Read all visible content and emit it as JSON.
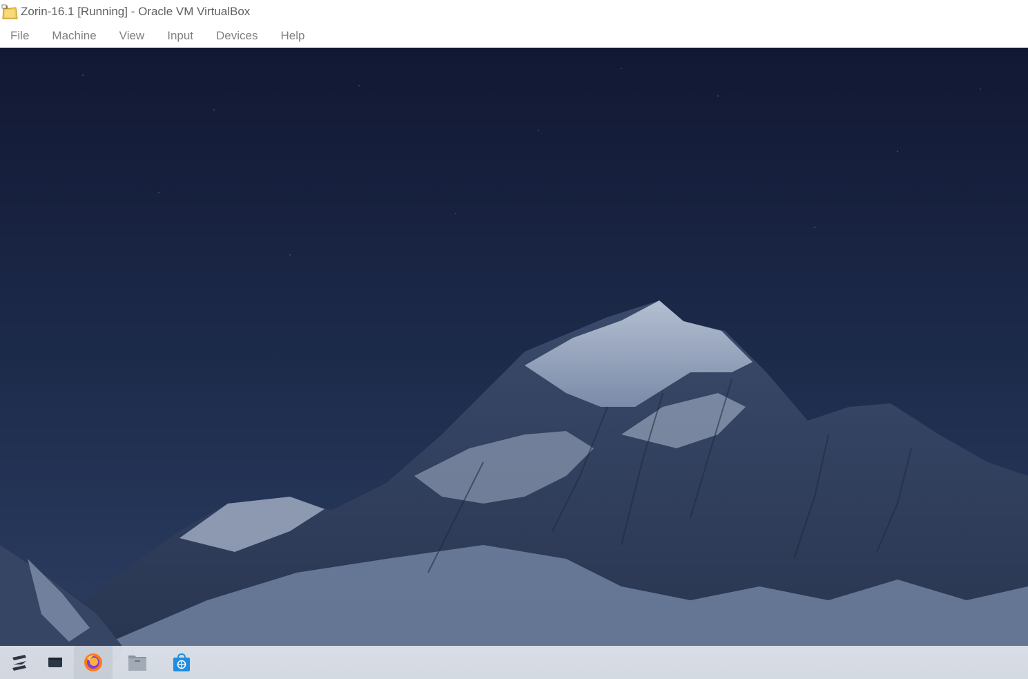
{
  "window": {
    "title": "Zorin-16.1 [Running] - Oracle VM VirtualBox",
    "icon": "virtualbox-folder-icon"
  },
  "menubar": {
    "items": [
      {
        "label": "File"
      },
      {
        "label": "Machine"
      },
      {
        "label": "View"
      },
      {
        "label": "Input"
      },
      {
        "label": "Devices"
      },
      {
        "label": "Help"
      }
    ]
  },
  "desktop": {
    "wallpaper": "mountain-at-night",
    "sky_color": "#1b2542"
  },
  "taskbar": {
    "items": [
      {
        "icon": "zorin-menu-icon"
      },
      {
        "icon": "workspace-overview-icon"
      },
      {
        "icon": "firefox-icon",
        "active": true
      },
      {
        "icon": "files-folder-icon"
      },
      {
        "icon": "software-store-icon"
      }
    ]
  }
}
